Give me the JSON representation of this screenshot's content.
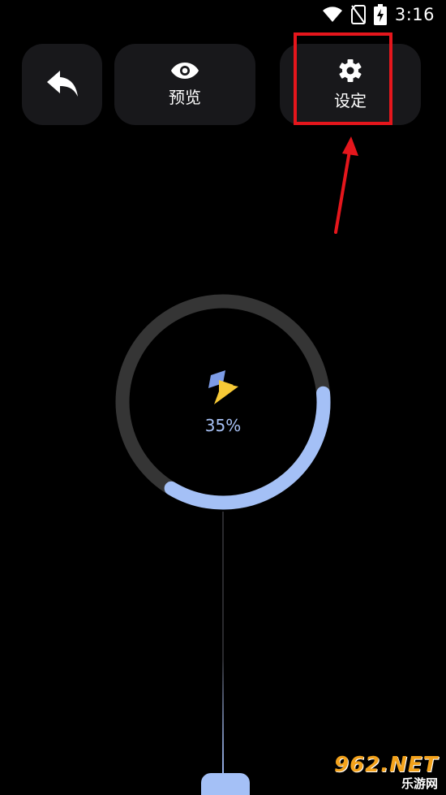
{
  "status_bar": {
    "time": "3:16",
    "icons": [
      "wifi-icon",
      "no-sim-icon",
      "battery-charging-icon"
    ]
  },
  "toolbar": {
    "back_icon": "back-arrow-icon",
    "preview_icon": "eye-icon",
    "preview_label": "预览",
    "settings_icon": "gear-icon",
    "settings_label": "设定"
  },
  "annotation": {
    "highlight_color": "#e5161c"
  },
  "charging": {
    "icon": "lightning-bolt-icon",
    "percent_text": "35%",
    "progress_fraction": 0.35,
    "track_color": "#353535",
    "fill_color": "#a4c0f6",
    "bolt_blue": "#7d9ce6",
    "bolt_yellow": "#f7c936"
  },
  "watermark": {
    "main": "962.NET",
    "sub": "乐游网"
  }
}
